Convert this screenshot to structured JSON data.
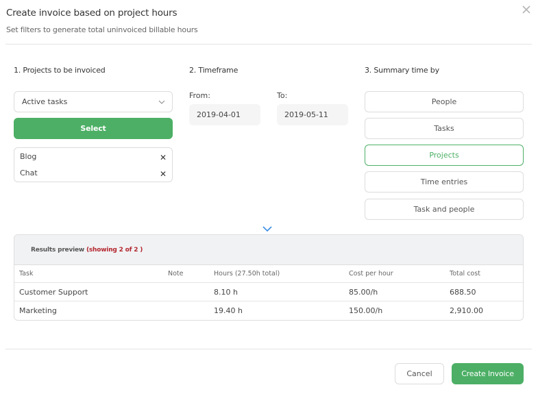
{
  "dialog": {
    "title": "Create invoice based on project hours",
    "subtitle": "Set filters to generate total uninvoiced billable hours",
    "close_icon": "close-icon"
  },
  "projects": {
    "label": "1. Projects to be invoiced",
    "dropdown_value": "Active tasks",
    "select_label": "Select",
    "selected": [
      {
        "name": "Blog"
      },
      {
        "name": "Chat"
      }
    ]
  },
  "timeframe": {
    "label": "2. Timeframe",
    "from_label": "From:",
    "from_value": "2019-04-01",
    "to_label": "To:",
    "to_value": "2019-05-11"
  },
  "summary": {
    "label": "3. Summary time by",
    "options": [
      {
        "label": "People",
        "active": false
      },
      {
        "label": "Tasks",
        "active": false
      },
      {
        "label": "Projects",
        "active": true
      },
      {
        "label": "Time entries",
        "active": false
      },
      {
        "label": "Task and people",
        "active": false
      }
    ]
  },
  "results": {
    "label": "Results preview",
    "count": "(showing 2 of 2 )",
    "columns": [
      "Task",
      "Note",
      "Hours (27.50h total)",
      "Cost per hour",
      "Total cost"
    ],
    "rows": [
      {
        "task": "Customer Support",
        "note": "",
        "hours": "8.10 h",
        "cost_per_hour": "85.00/h",
        "total_cost": "688.50"
      },
      {
        "task": "Marketing",
        "note": "",
        "hours": "19.40 h",
        "cost_per_hour": "150.00/h",
        "total_cost": "2,910.00"
      }
    ]
  },
  "footer": {
    "cancel_label": "Cancel",
    "create_label": "Create Invoice"
  },
  "colors": {
    "accent_green": "#4caf65",
    "count_red": "#b3262d",
    "chevron_blue": "#3a8ee6"
  }
}
